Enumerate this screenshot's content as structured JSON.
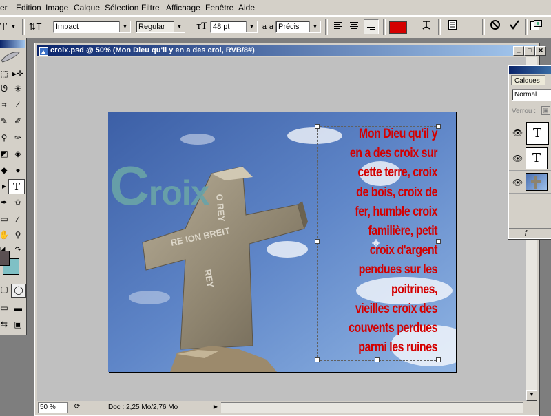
{
  "menu": [
    "er",
    "Edition",
    "Image",
    "Calque",
    "Sélection",
    "Filtre",
    "Affichage",
    "Fenêtre",
    "Aide"
  ],
  "options": {
    "tool_glyph": "T",
    "font_family": "Impact",
    "font_style": "Regular",
    "font_size": "48 pt",
    "antialias_glyph": "a a",
    "antialias": "Précis",
    "text_color": "#d40000"
  },
  "document": {
    "title": "croix.psd @ 50% (Mon Dieu qu'il y en a des croi, RVB/8#)",
    "zoom": "50 %",
    "doc_info": "Doc : 2,25 Mo/2,76 Mo",
    "big_word_first": "C",
    "big_word_rest": "roix",
    "poem_lines": [
      "Mon Dieu qu'il y",
      "en a des croix sur",
      "cette terre, croix",
      "de bois, croix de",
      "fer, humble croix",
      "familière, petit",
      "croix d'argent",
      "pendues sur les",
      "poitrines,",
      "vieilles croix des",
      "couvents perdues",
      "parmi les ruines"
    ]
  },
  "layers_panel": {
    "tab": "Calques",
    "blend_mode": "Normal",
    "lock_label": "Verrou :",
    "layers": [
      {
        "thumb": "T"
      },
      {
        "thumb": "T"
      },
      {
        "thumb": ""
      }
    ]
  },
  "toolbox": {
    "type_tool_glyph": "T",
    "foreground_color": "#5a5052",
    "background_color": "#7fc0c5"
  }
}
